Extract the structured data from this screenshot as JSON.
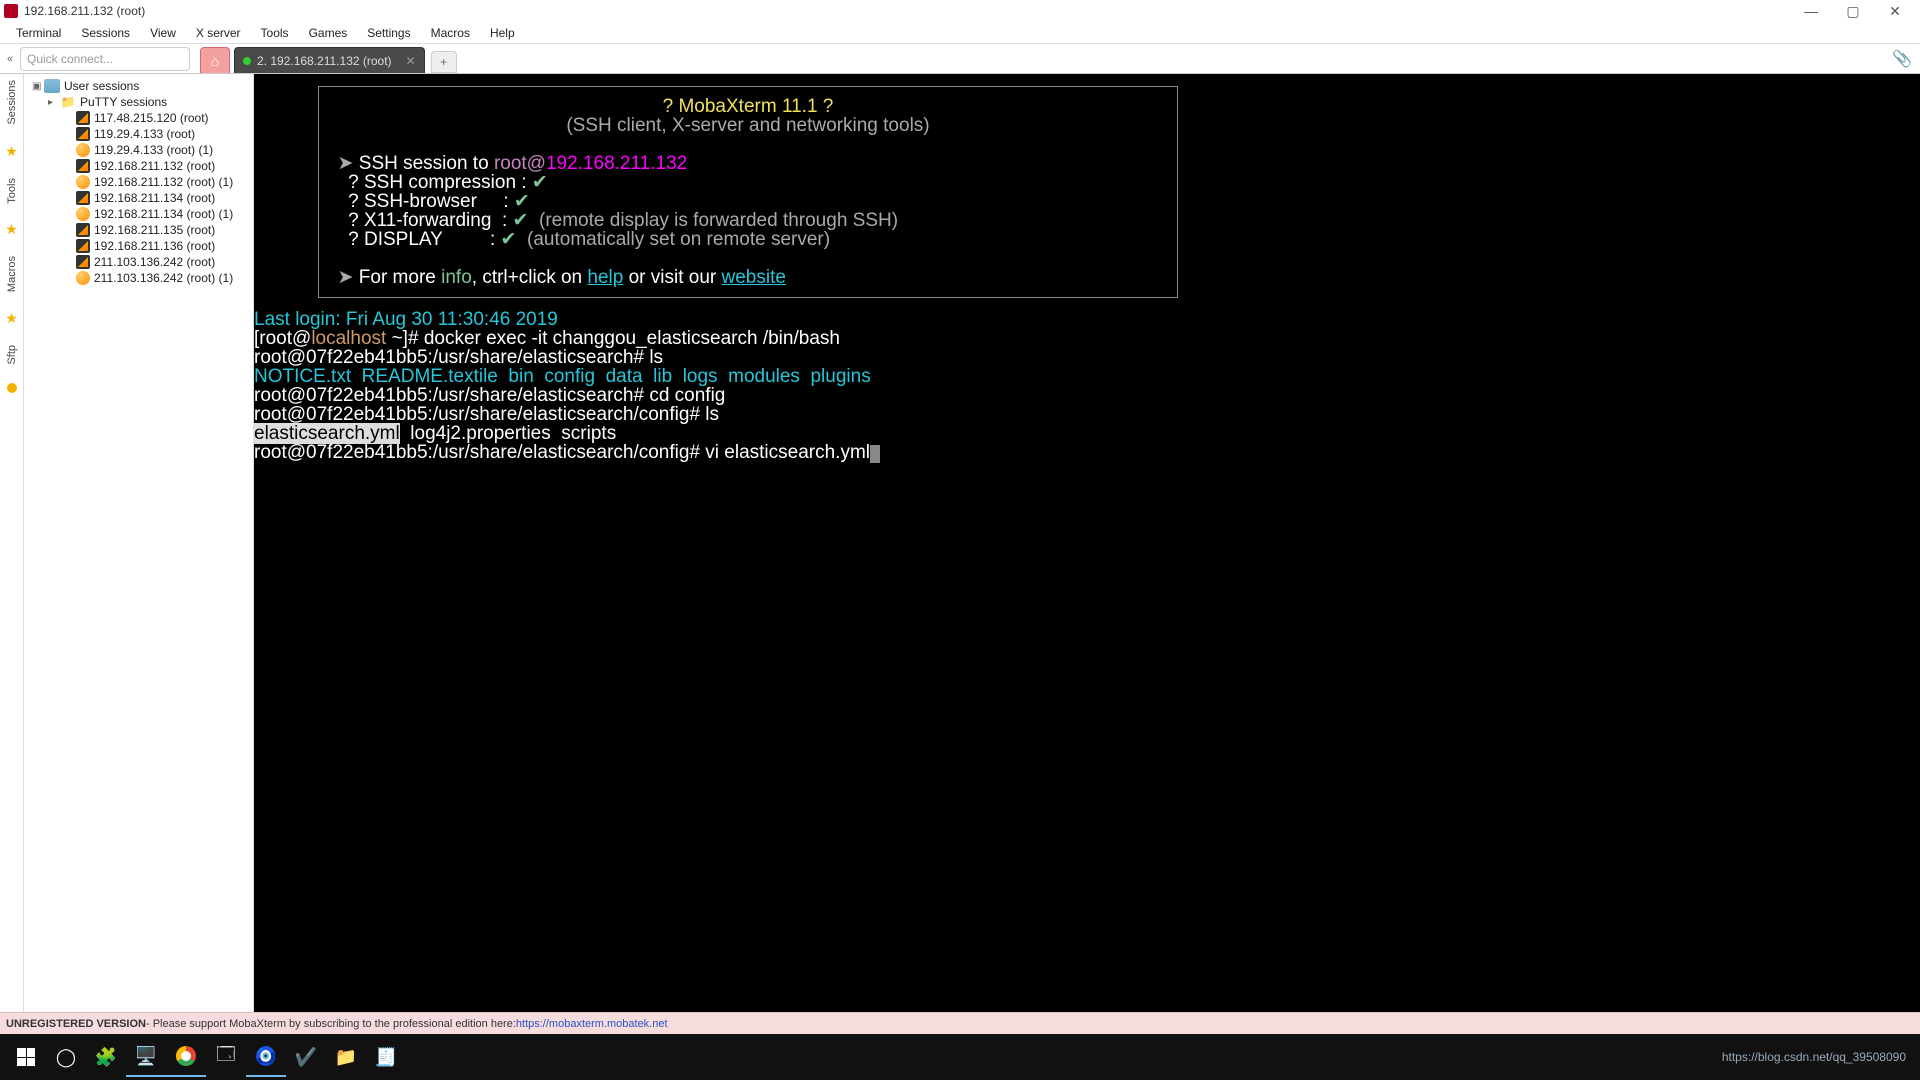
{
  "title": "192.168.211.132 (root)",
  "menus": [
    "Terminal",
    "Sessions",
    "View",
    "X server",
    "Tools",
    "Games",
    "Settings",
    "Macros",
    "Help"
  ],
  "quick_connect_placeholder": "Quick connect...",
  "left_labels": [
    "Sessions",
    "Tools",
    "Macros",
    "Sftp"
  ],
  "tab_label": "2. 192.168.211.132 (root)",
  "tree": {
    "root": "User sessions",
    "putty": "PuTTY sessions",
    "items": [
      {
        "icon": "y",
        "label": "117.48.215.120 (root)"
      },
      {
        "icon": "y",
        "label": "119.29.4.133 (root)"
      },
      {
        "icon": "o",
        "label": "119.29.4.133 (root) (1)"
      },
      {
        "icon": "y",
        "label": "192.168.211.132 (root)"
      },
      {
        "icon": "o",
        "label": "192.168.211.132 (root) (1)"
      },
      {
        "icon": "y",
        "label": "192.168.211.134 (root)"
      },
      {
        "icon": "o",
        "label": "192.168.211.134 (root) (1)"
      },
      {
        "icon": "y",
        "label": "192.168.211.135 (root)"
      },
      {
        "icon": "y",
        "label": "192.168.211.136 (root)"
      },
      {
        "icon": "y",
        "label": "211.103.136.242 (root)"
      },
      {
        "icon": "o",
        "label": "211.103.136.242 (root) (1)"
      }
    ]
  },
  "banner": {
    "l1": "? MobaXterm 11.1 ?",
    "l2": "(SSH client, X-server and networking tools)",
    "ssh_pre": "SSH session to ",
    "ssh_user": "root@",
    "ssh_host": "192.168.211.132",
    "r1": "? SSH compression : ",
    "r2": "? SSH-browser     : ",
    "r3": "? X11-forwarding  : ",
    "r3b": "  (remote display is forwarded through SSH)",
    "r4": "? DISPLAY         : ",
    "r4b": "  (automatically set on remote server)",
    "more": "For more ",
    "info": "info",
    "more2": ", ctrl+click on ",
    "help": "help",
    "more3": " or visit our ",
    "website": "website"
  },
  "term": {
    "last_login": "Last login: Fri Aug 30 11:30:46 2019",
    "p1a": "[root@",
    "p1host": "localhost",
    "p1b": " ~]# ",
    "cmd1": "docker exec -it changgou_elasticsearch /bin/bash",
    "p2": "root@07f22eb41bb5:/usr/share/elasticsearch# ",
    "cmd2": "ls",
    "ls1": "NOTICE.txt  README.textile  bin  config  data  lib  logs  modules  plugins",
    "cmd3": "cd config",
    "p3": "root@07f22eb41bb5:/usr/share/elasticsearch/config# ",
    "cmd4": "ls",
    "f_hl": "elasticsearch.yml",
    "f_rest": "  log4j2.properties  scripts",
    "cmd5": "vi elasticsearch.yml"
  },
  "status": {
    "left": "UNREGISTERED VERSION",
    "mid": " - Please support MobaXterm by subscribing to the professional edition here: ",
    "link": "https://mobaxterm.mobatek.net"
  },
  "watermark": "https://blog.csdn.net/qq_39508090"
}
